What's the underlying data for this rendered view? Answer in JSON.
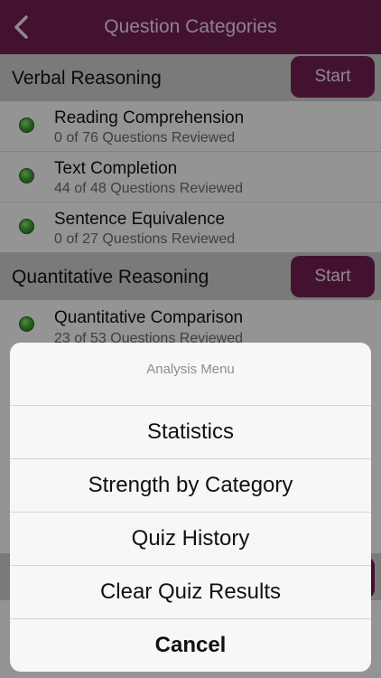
{
  "nav": {
    "title": "Question Categories"
  },
  "sections": [
    {
      "title": "Verbal Reasoning",
      "start_label": "Start",
      "items": [
        {
          "title": "Reading Comprehension",
          "subtitle": "0 of 76 Questions Reviewed"
        },
        {
          "title": "Text Completion",
          "subtitle": "44 of 48 Questions Reviewed"
        },
        {
          "title": "Sentence Equivalence",
          "subtitle": "0 of 27 Questions Reviewed"
        }
      ]
    },
    {
      "title": "Quantitative Reasoning",
      "start_label": "Start",
      "items": [
        {
          "title": "Quantitative Comparison",
          "subtitle": "23 of 53 Questions Reviewed"
        }
      ]
    }
  ],
  "menu": {
    "title": "Analysis Menu",
    "options": [
      "Statistics",
      "Strength by Category",
      "Quiz History",
      "Clear Quiz Results"
    ],
    "cancel_label": "Cancel"
  },
  "colors": {
    "brand": "#6c1d4f",
    "status_dot": "#3ea22e"
  }
}
